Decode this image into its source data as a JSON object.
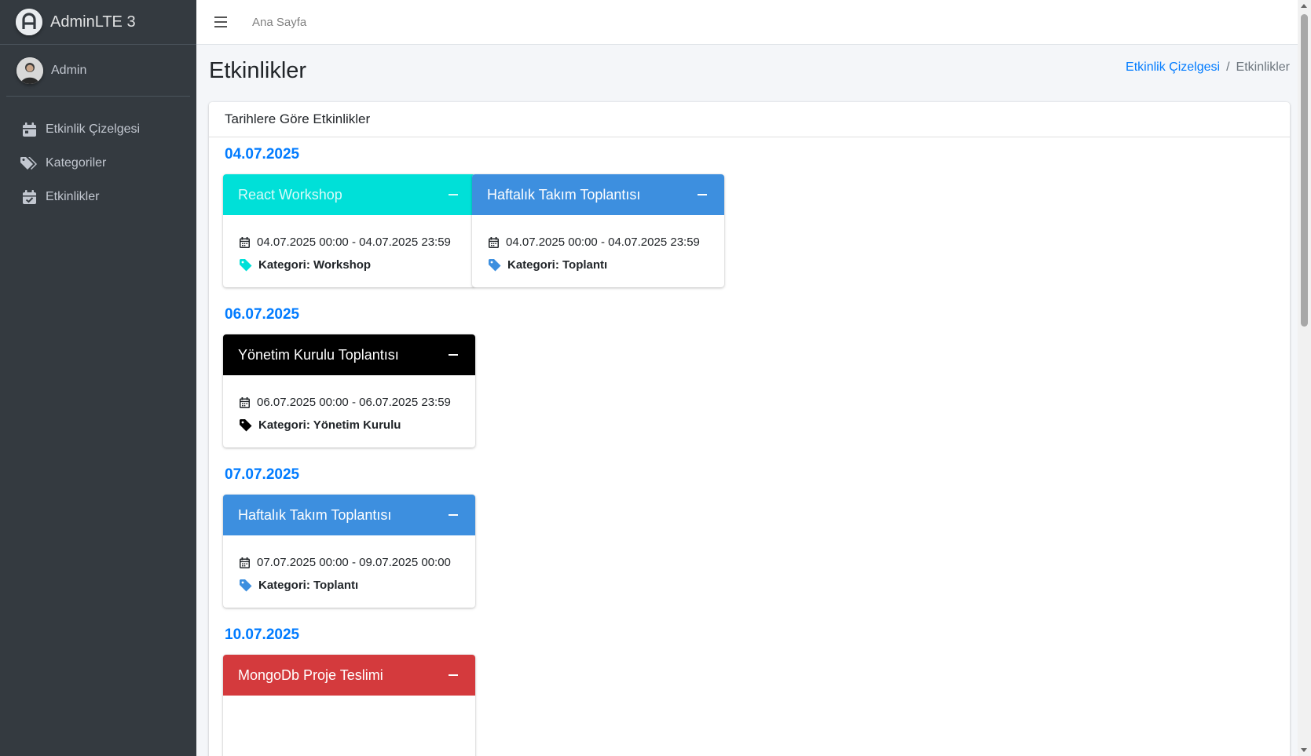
{
  "brand": {
    "title": "AdminLTE 3"
  },
  "user": {
    "name": "Admin"
  },
  "sidebar": {
    "items": [
      {
        "label": "Etkinlik Çizelgesi",
        "icon": "calendar-icon"
      },
      {
        "label": "Kategoriler",
        "icon": "tags-icon"
      },
      {
        "label": "Etkinlikler",
        "icon": "calendar-check-icon"
      }
    ]
  },
  "header": {
    "home_label": "Ana Sayfa"
  },
  "page": {
    "title": "Etkinlikler",
    "breadcrumb": {
      "link": "Etkinlik Çizelgesi",
      "separator": "/",
      "active": "Etkinlikler"
    }
  },
  "main_card": {
    "title": "Tarihlere Göre Etkinlikler"
  },
  "groups": [
    {
      "date": "04.07.2025",
      "events": [
        {
          "title": "React Workshop",
          "time": "04.07.2025 00:00 - 04.07.2025 23:59",
          "category": "Kategori: Workshop",
          "color": "#00e0d8",
          "title_color": "rgba(255,255,255,0.85)"
        },
        {
          "title": "Haftalık Takım Toplantısı",
          "time": "04.07.2025 00:00 - 04.07.2025 23:59",
          "category": "Kategori: Toplantı",
          "color": "#3d8fdf",
          "title_color": "#ffffff"
        }
      ]
    },
    {
      "date": "06.07.2025",
      "events": [
        {
          "title": "Yönetim Kurulu Toplantısı",
          "time": "06.07.2025 00:00 - 06.07.2025 23:59",
          "category": "Kategori: Yönetim Kurulu",
          "color": "#000000",
          "title_color": "#ffffff"
        }
      ]
    },
    {
      "date": "07.07.2025",
      "events": [
        {
          "title": "Haftalık Takım Toplantısı",
          "time": "07.07.2025 00:00 - 09.07.2025 00:00",
          "category": "Kategori: Toplantı",
          "color": "#3d8fdf",
          "title_color": "#ffffff"
        }
      ]
    },
    {
      "date": "10.07.2025",
      "events": [
        {
          "title": "MongoDb Proje Teslimi",
          "time": "",
          "category": "",
          "color": "#d43a3d",
          "title_color": "#ffffff"
        }
      ]
    }
  ],
  "colors": {
    "sidebar_bg": "#343a40",
    "link": "#007bff",
    "page_bg": "#f4f6f9"
  }
}
